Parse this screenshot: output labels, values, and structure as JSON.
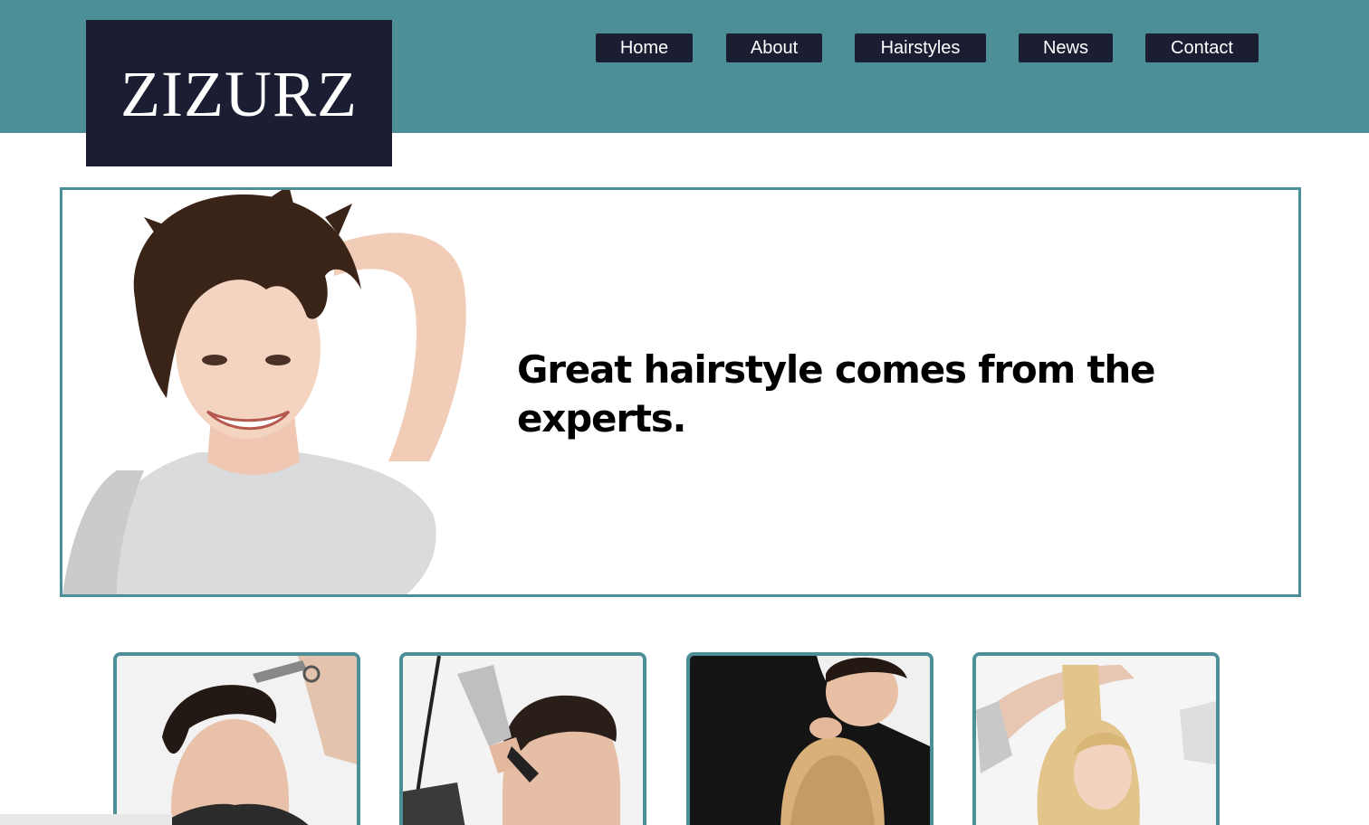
{
  "brand": {
    "logo_text": "ZIZURZ",
    "header_color": "#4d8f96",
    "dark_color": "#1b1d33"
  },
  "nav": {
    "items": [
      {
        "label": "Home"
      },
      {
        "label": "About"
      },
      {
        "label": "Hairstyles"
      },
      {
        "label": "News"
      },
      {
        "label": "Contact"
      }
    ]
  },
  "hero": {
    "headline": "Great hairstyle comes from the experts."
  },
  "cards": [
    {
      "icon": "barber-scissors-photo"
    },
    {
      "icon": "hair-clipper-photo"
    },
    {
      "icon": "stylist-cutting-photo"
    },
    {
      "icon": "blonde-hair-styling-photo"
    }
  ]
}
